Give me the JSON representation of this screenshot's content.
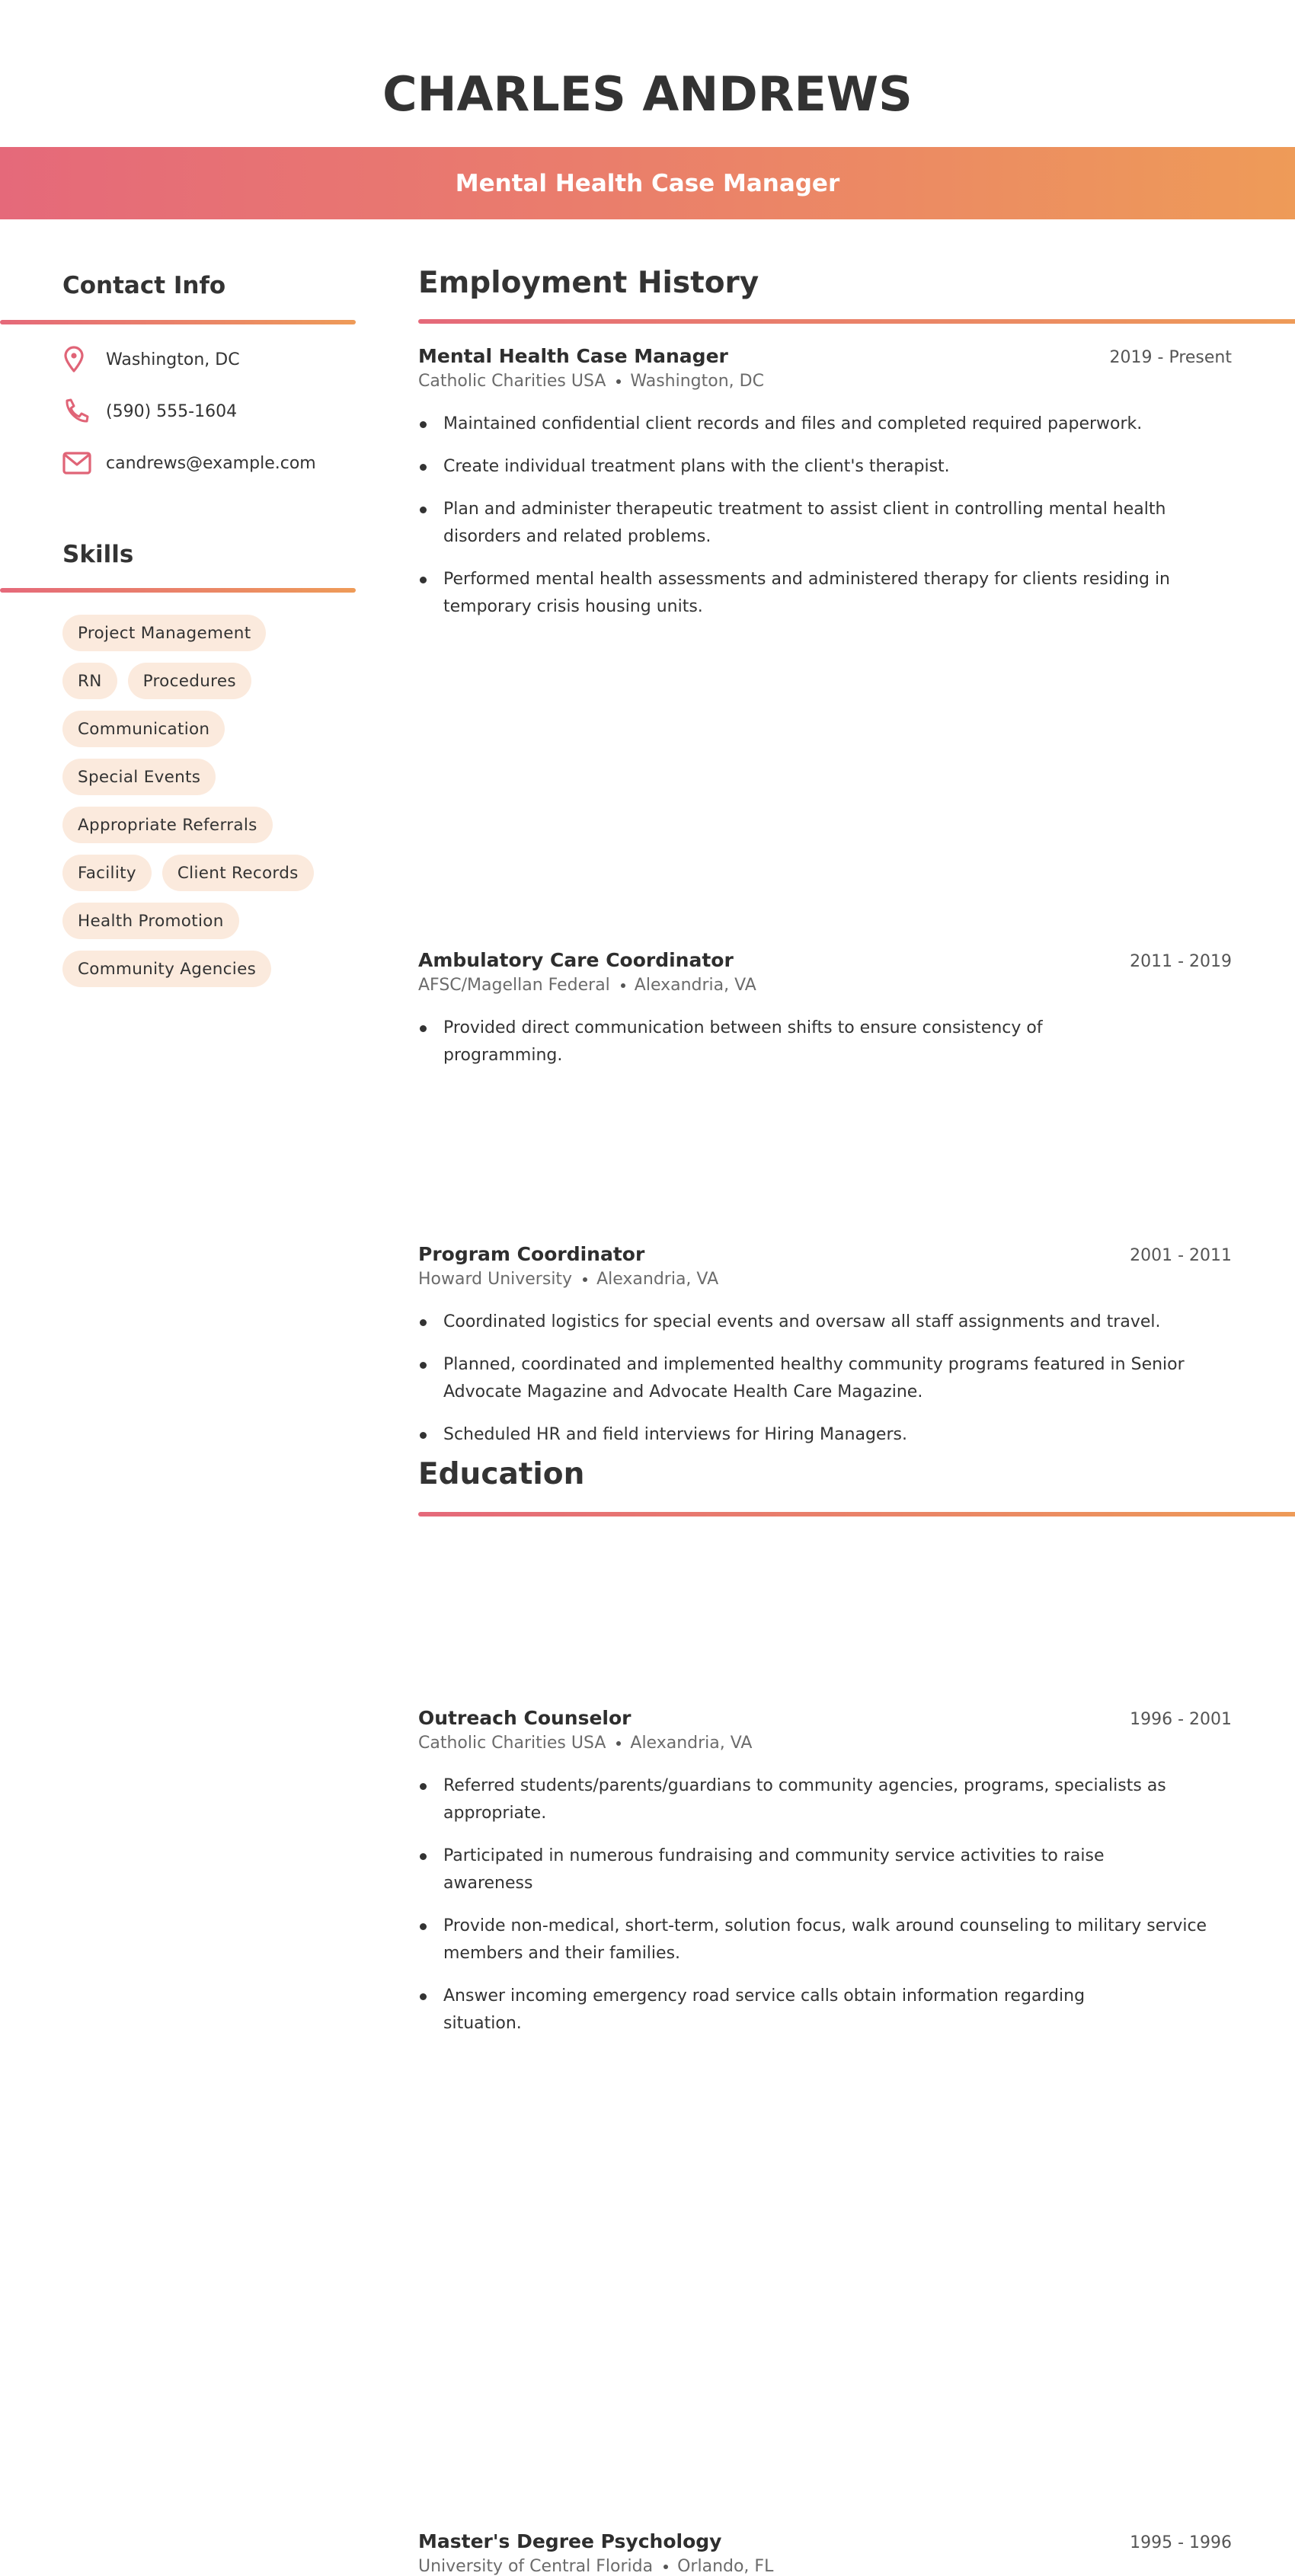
{
  "header": {
    "name": "CHARLES ANDREWS",
    "job_title": "Mental Health Case Manager"
  },
  "colors": {
    "gradient_start": "#e5697a",
    "gradient_end": "#ee9b58",
    "icon": "#e06477",
    "pill_background": "#fbeadd",
    "text_dark": "#333333",
    "text_muted": "#6b6b6b"
  },
  "contact": {
    "heading": "Contact Info",
    "items": [
      {
        "icon": "map-pin-icon",
        "text": "Washington, DC"
      },
      {
        "icon": "phone-icon",
        "text": "(590) 555-1604"
      },
      {
        "icon": "envelope-icon",
        "text": "candrews@example.com"
      }
    ]
  },
  "skills": {
    "heading": "Skills",
    "rows": [
      [
        "Project Management"
      ],
      [
        "RN",
        "Procedures"
      ],
      [
        "Communication"
      ],
      [
        "Special Events"
      ],
      [
        "Appropriate Referrals"
      ],
      [
        "Facility",
        "Client Records"
      ],
      [
        "Health Promotion"
      ],
      [
        "Community Agencies"
      ]
    ]
  },
  "employment": {
    "heading": "Employment History",
    "jobs": [
      {
        "title": "Mental Health Case Manager",
        "dates": "2019 - Present",
        "company": "Catholic Charities USA",
        "location": "Washington, DC",
        "bullets": [
          "Maintained confidential client records and files and completed required paperwork.",
          "Create individual treatment plans with the client's therapist.",
          "Plan and administer therapeutic treatment to assist client in controlling mental health disorders and related problems.",
          "Performed mental health assessments and administered therapy for clients residing in temporary crisis housing units."
        ]
      },
      {
        "title": "Ambulatory Care Coordinator",
        "dates": "2011 - 2019",
        "company": "AFSC/Magellan Federal",
        "location": "Alexandria, VA",
        "bullets": [
          "Provided direct communication between shifts to ensure consistency of programming."
        ]
      },
      {
        "title": "Program Coordinator",
        "dates": "2001 - 2011",
        "company": "Howard University",
        "location": "Alexandria, VA",
        "bullets": [
          "Coordinated logistics for special events and oversaw all staff assignments and travel.",
          "Planned, coordinated and implemented healthy community programs featured in Senior Advocate Magazine and Advocate Health Care Magazine.",
          "Scheduled HR and field interviews for Hiring Managers."
        ]
      },
      {
        "title": "Outreach Counselor",
        "dates": "1996 - 2001",
        "company": "Catholic Charities USA",
        "location": "Alexandria, VA",
        "bullets": [
          "Referred students/parents/guardians to community agencies, programs, specialists as appropriate.",
          "Participated in numerous fundraising and community service activities to raise awareness",
          "Provide non-medical, short-term, solution focus, walk around counseling to military service members and their families.",
          "Answer incoming emergency road service calls obtain information regarding situation."
        ]
      }
    ]
  },
  "education": {
    "heading": "Education",
    "entries": [
      {
        "title": "Master's Degree Psychology",
        "dates": "1995 - 1996",
        "school": "University of Central Florida",
        "location": "Orlando, FL"
      }
    ]
  }
}
